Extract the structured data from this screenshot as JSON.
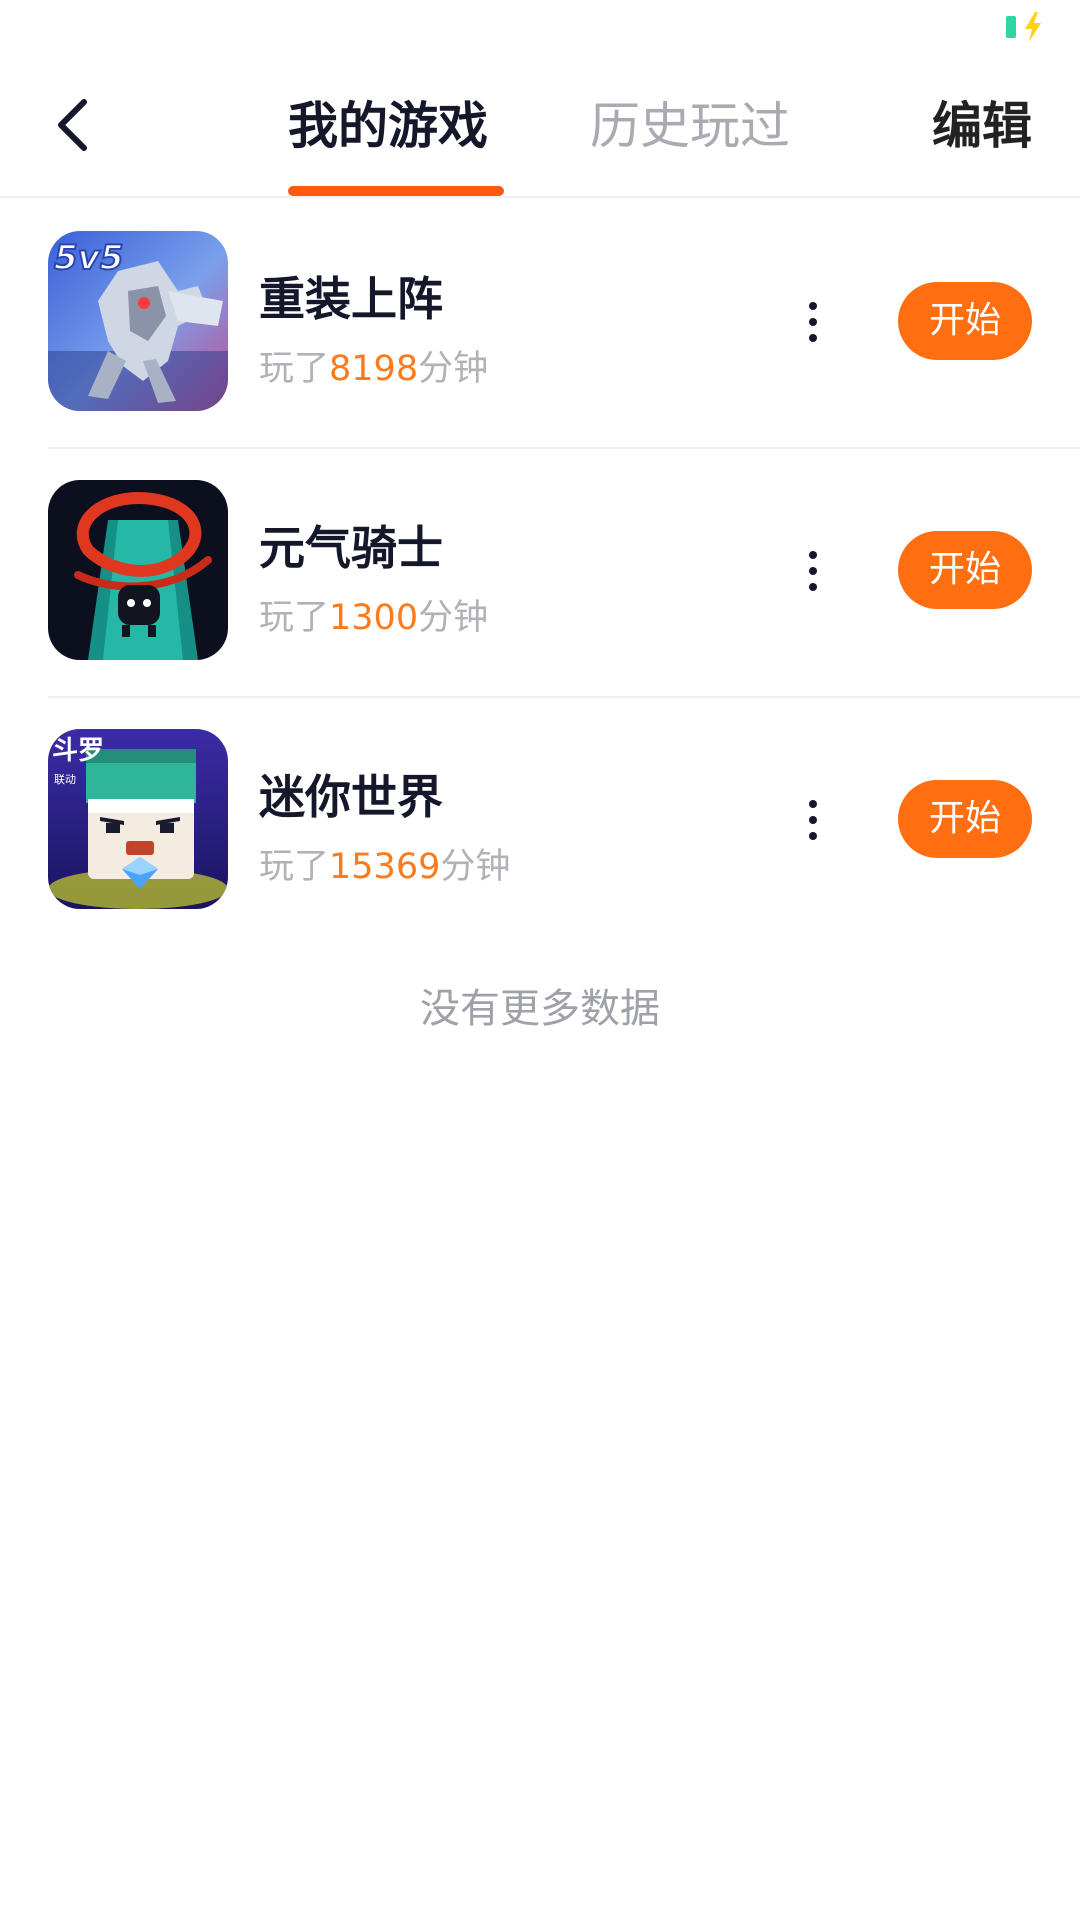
{
  "nav": {
    "tab_active": "我的游戏",
    "tab_inactive": "历史玩过",
    "edit_label": "编辑"
  },
  "colors": {
    "accent": "#ff6f12",
    "indicator": "#ff5a10",
    "battery": "#2fd6a4",
    "bolt": "#ffd11a"
  },
  "games": [
    {
      "title": "重装上阵",
      "prefix": "玩了",
      "minutes": "8198",
      "suffix": "分钟",
      "icon": "mech-robot-5v5-icon",
      "icon_text": "5v5",
      "start_label": "开始"
    },
    {
      "title": "元气骑士",
      "prefix": "玩了",
      "minutes": "1300",
      "suffix": "分钟",
      "icon": "soul-knight-icon",
      "start_label": "开始"
    },
    {
      "title": "迷你世界",
      "prefix": "玩了",
      "minutes": "15369",
      "suffix": "分钟",
      "icon": "mini-world-icon",
      "icon_text": "斗罗",
      "icon_subtext": "联动",
      "start_label": "开始"
    }
  ],
  "footer": {
    "no_more": "没有更多数据"
  }
}
